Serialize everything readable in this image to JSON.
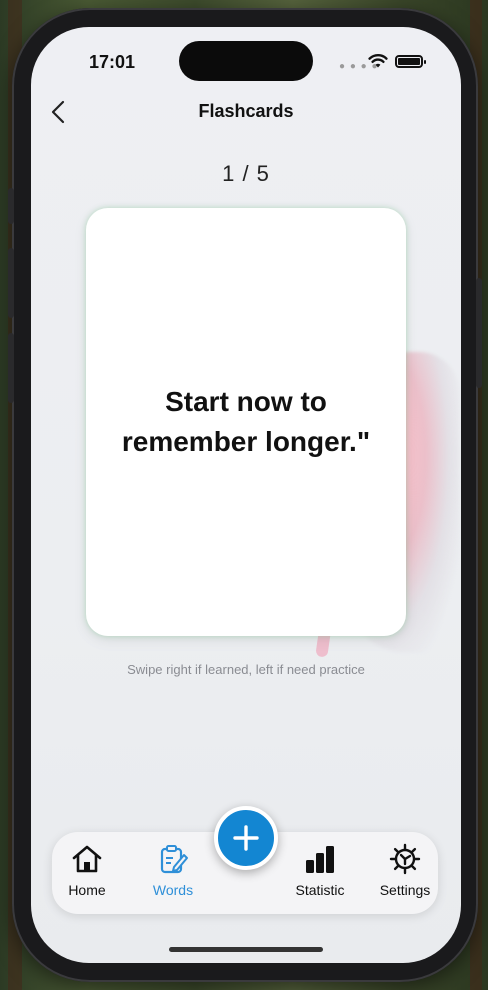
{
  "status_bar": {
    "time": "17:01",
    "signal_icon": "cellular-signal-icon",
    "wifi_icon": "wifi-icon",
    "battery_icon": "battery-icon"
  },
  "nav": {
    "back_icon": "chevron-left-icon",
    "title": "Flashcards"
  },
  "counter": "1 / 5",
  "card": {
    "text": "Start now to remember longer.\""
  },
  "hint": "Swipe right if learned, left if need practice",
  "tabbar": {
    "items": [
      {
        "label": "Home",
        "icon": "house-icon",
        "active": false
      },
      {
        "label": "Words",
        "icon": "notepad-pencil-icon",
        "active": true
      },
      {
        "label": "Statistic",
        "icon": "bar-chart-icon",
        "active": false
      },
      {
        "label": "Settings",
        "icon": "gear-icon",
        "active": false
      }
    ],
    "fab_icon": "plus-icon"
  },
  "colors": {
    "accent": "#2e8fd8",
    "fab": "#1386d2",
    "background": "#eeeff3"
  }
}
